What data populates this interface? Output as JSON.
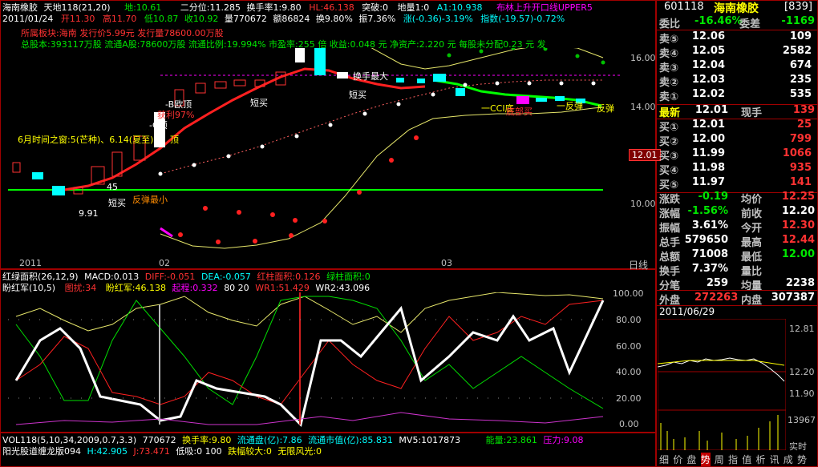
{
  "header": {
    "stock_name": "海南橡胶",
    "tianda": "天地118(21,20)",
    "di": "地:10.61",
    "erfenwei": "二分位:11.285",
    "turnover": "换手率1:9.80",
    "h_m": "HL:46.138",
    "tupo": "突破:0",
    "diliang": "地量1:0",
    "a1": "A1:10.938",
    "boll_msg": "布林上升开口线UPPER5"
  },
  "info_line": {
    "date": "2011/01/24",
    "open": "开11.30",
    "high": "高11.70",
    "low": "低10.87",
    "close": "收10.92",
    "volume": "量770672",
    "amount": "额86824",
    "turnover": "换9.80%",
    "amplitude": "振7.36%",
    "change": "涨(-0.36)-3.19%",
    "index": "指数(-19.57)-0.72%"
  },
  "f10": {
    "line1": "所属板块:海南  发行价5.99元  发行量78600.00万股",
    "line2": "总股本:393117万股  流通A股:78600万股  流通比例:19.994%  市盈率:255 倍  收益:0.048 元  净资产:2.220 元  每股未分配0.23 元  发"
  },
  "annotations": {
    "a1": "-B欧顶",
    "a2": "-C顶",
    "a3": "短买",
    "a4": "短买",
    "a5": "顶",
    "a6": "6月时间之窗:5(芒种)、6.14(夏至)",
    "a7": "短买",
    "a8": "反弹最小",
    "a9": "45",
    "a10": "9.91",
    "a11": "一CCI底",
    "a12": "底部买",
    "a13": "反弹",
    "a14": "一反弹",
    "a15": "换手最大",
    "a16": "获利97%"
  },
  "price_axis": {
    "ticks": [
      "16.00",
      "14.00",
      "12.00",
      "10.00"
    ],
    "current_price": "12.01"
  },
  "date_axis": {
    "labels": [
      "2011",
      "02",
      "03"
    ],
    "right_label": "日线"
  },
  "macd_bar": {
    "title": "红绿面积(26,12,9)",
    "macd": "MACD:0.013",
    "diff": "DIFF:-0.051",
    "dea": "DEA:-0.057",
    "red_area": "红柱面积:0.126",
    "green_area": "绿柱面积:0"
  },
  "sub_chart": {
    "title": "盼红军(10,5)",
    "tuyi": "图扰:34",
    "panhong": "盼红军:46.138",
    "qicheng": "起程:0.332",
    "lvl": "80 20",
    "wr1": "WR1:51.429",
    "wr2": "WR2:43.096",
    "ticks": [
      "100.00",
      "80.00",
      "60.00",
      "40.00",
      "20.00",
      "0.00"
    ]
  },
  "bottom_lines": {
    "line1_a": "VOL118(5,10,34,2009,0.7,3.3)",
    "line1_b": "770672",
    "line1_c": "换手率:9.80",
    "line1_d": "流通盘(亿):7.86",
    "line1_e": "流通市值(亿):85.831",
    "line1_f": "MV5:1017873",
    "line1_g": "能量:23.861",
    "line1_h": "压力:9.08",
    "line2_a": "阳光股道缠龙版094",
    "line2_b": "H:42.905",
    "line2_c": "J:73.471",
    "line2_d": "低吸:0 100",
    "line2_e": "跌幅较大:0",
    "line2_f": "无限风光:0"
  },
  "quote": {
    "code": "601118",
    "name": "海南橡胶",
    "code_num": "[839]",
    "weibi_label": "委比",
    "weibi_val": "-16.46%",
    "weicha_label": "委差",
    "weicha_val": "-1169",
    "asks": [
      {
        "label": "卖⑤",
        "price": "12.06",
        "vol": "109"
      },
      {
        "label": "卖④",
        "price": "12.05",
        "vol": "2582"
      },
      {
        "label": "卖③",
        "price": "12.04",
        "vol": "674"
      },
      {
        "label": "卖②",
        "price": "12.03",
        "vol": "235"
      },
      {
        "label": "卖①",
        "price": "12.02",
        "vol": "535"
      }
    ],
    "last": {
      "label": "最新",
      "price": "12.01",
      "xs_label": "现手",
      "xs": "139"
    },
    "bids": [
      {
        "label": "买①",
        "price": "12.01",
        "vol": "25"
      },
      {
        "label": "买②",
        "price": "12.00",
        "vol": "799"
      },
      {
        "label": "买③",
        "price": "11.99",
        "vol": "1066"
      },
      {
        "label": "买④",
        "price": "11.98",
        "vol": "935"
      },
      {
        "label": "买⑤",
        "price": "11.97",
        "vol": "141"
      }
    ],
    "stats": [
      {
        "l1": "涨跌",
        "v1": "-0.19",
        "l2": "均价",
        "v2": "12.25",
        "c1": "c-green",
        "c2": "c-red"
      },
      {
        "l1": "涨幅",
        "v1": "-1.56%",
        "l2": "前收",
        "v2": "12.20",
        "c1": "c-green",
        "c2": "c-white"
      },
      {
        "l1": "振幅",
        "v1": "3.61%",
        "l2": "今开",
        "v2": "12.30",
        "c1": "c-white",
        "c2": "c-red"
      },
      {
        "l1": "总手",
        "v1": "579650",
        "l2": "最高",
        "v2": "12.44",
        "c1": "c-white",
        "c2": "c-red"
      },
      {
        "l1": "总额",
        "v1": "71008",
        "l2": "最低",
        "v2": "12.00",
        "c1": "c-white",
        "c2": "c-green"
      },
      {
        "l1": "换手",
        "v1": "7.37%",
        "l2": "量比",
        "v2": "",
        "c1": "c-white",
        "c2": "c-white"
      },
      {
        "l1": "分笔",
        "v1": "259",
        "l2": "均量",
        "v2": "2238",
        "c1": "c-white",
        "c2": "c-white"
      }
    ],
    "waipan_label": "外盘",
    "waipan": "272263",
    "neipan_label": "内盘",
    "neipan": "307387"
  },
  "mini": {
    "date": "2011/06/29",
    "ticks": [
      "12.81",
      "12.20",
      "11.90"
    ],
    "vol_tick": "13967",
    "realtime": "实时"
  },
  "tabs": [
    "细",
    "价",
    "盘",
    "势",
    "周",
    "指",
    "值",
    "析",
    "讯",
    "成",
    "势"
  ],
  "active_tab": 3
}
